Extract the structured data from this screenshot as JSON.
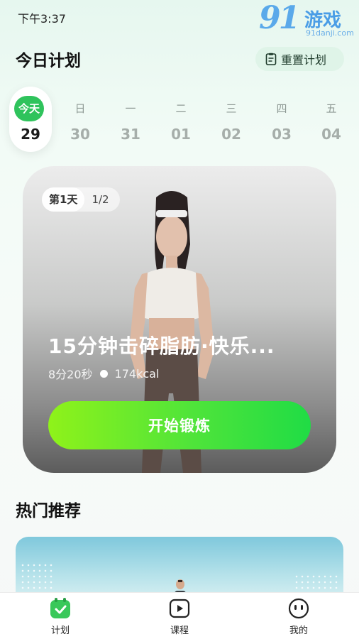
{
  "status_bar": {
    "time": "下午3:37"
  },
  "watermark": {
    "logo_number": "91",
    "logo_text": "游戏",
    "url": "91danji.com"
  },
  "header": {
    "title": "今日计划",
    "reset_label": "重置计划",
    "reset_icon": "clipboard-icon"
  },
  "dates": [
    {
      "weekday": "今天",
      "day": "29",
      "today": true
    },
    {
      "weekday": "日",
      "day": "30"
    },
    {
      "weekday": "一",
      "day": "31"
    },
    {
      "weekday": "二",
      "day": "01"
    },
    {
      "weekday": "三",
      "day": "02"
    },
    {
      "weekday": "四",
      "day": "03"
    },
    {
      "weekday": "五",
      "day": "04"
    }
  ],
  "hero": {
    "day_label": "第1天",
    "progress_label": "1/2",
    "title": "15分钟击碎脂肪·快乐...",
    "duration": "8分20秒",
    "calories": "174kcal",
    "start_label": "开始锻炼"
  },
  "recommend": {
    "title": "热门推荐"
  },
  "bottom_nav": [
    {
      "label": "计划",
      "icon": "plan-check-icon",
      "active": true
    },
    {
      "label": "课程",
      "icon": "play-icon"
    },
    {
      "label": "我的",
      "icon": "face-icon"
    }
  ],
  "colors": {
    "accent": "#2fc35c",
    "start_gradient_start": "#8ff21a",
    "start_gradient_end": "#20dc45"
  }
}
